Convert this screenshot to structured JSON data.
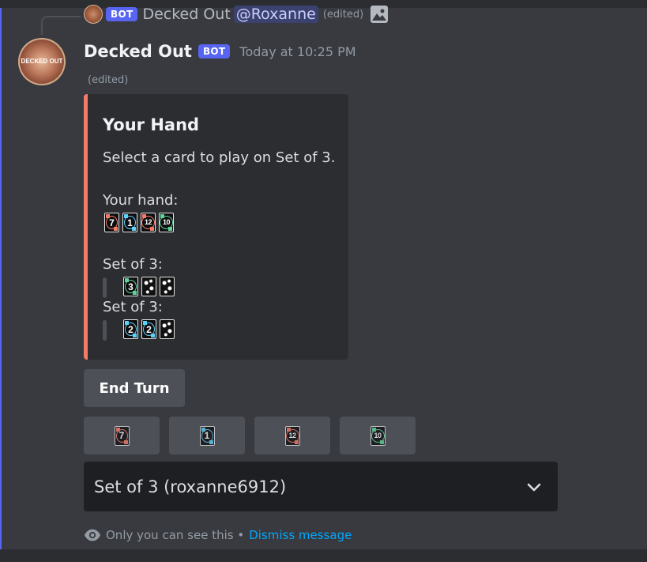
{
  "reply": {
    "bot_tag": "BOT",
    "author": "Decked Out",
    "mention": "@Roxanne",
    "edited": "(edited)"
  },
  "message": {
    "author": "Decked Out",
    "bot_tag": "BOT",
    "timestamp": "Today at 10:25 PM",
    "edited": "(edited)",
    "avatar_text": "DECKED OUT"
  },
  "embed": {
    "accent": "#f47b67",
    "title": "Your Hand",
    "description": "Select a card to play on Set of 3.",
    "hand_label": "Your hand:",
    "hand_cards": [
      {
        "value": "7",
        "color": "#f47b67"
      },
      {
        "value": "1",
        "color": "#5ed1f7"
      },
      {
        "value": "12",
        "color": "#f47b67"
      },
      {
        "value": "10",
        "color": "#5fd39a"
      }
    ],
    "sets": [
      {
        "label": "Set of 3:",
        "cards": [
          {
            "value": "3",
            "color": "#5fd39a"
          },
          {
            "value": "",
            "color": "wild"
          },
          {
            "value": "",
            "color": "wild"
          }
        ]
      },
      {
        "label": "Set of 3:",
        "cards": [
          {
            "value": "2",
            "color": "#5ed1f7"
          },
          {
            "value": "2",
            "color": "#5ed1f7"
          },
          {
            "value": "",
            "color": "wild"
          }
        ]
      }
    ]
  },
  "buttons": {
    "end_turn": "End Turn",
    "cards": [
      {
        "value": "7",
        "color": "#f47b67"
      },
      {
        "value": "1",
        "color": "#5ed1f7"
      },
      {
        "value": "12",
        "color": "#f47b67"
      },
      {
        "value": "10",
        "color": "#5fd39a"
      }
    ]
  },
  "select": {
    "value": "Set of 3 (roxanne6912)",
    "icon": "chevron-down-icon"
  },
  "footer": {
    "text": "Only you can see this •",
    "dismiss": "Dismiss message",
    "icon": "eye-icon"
  }
}
